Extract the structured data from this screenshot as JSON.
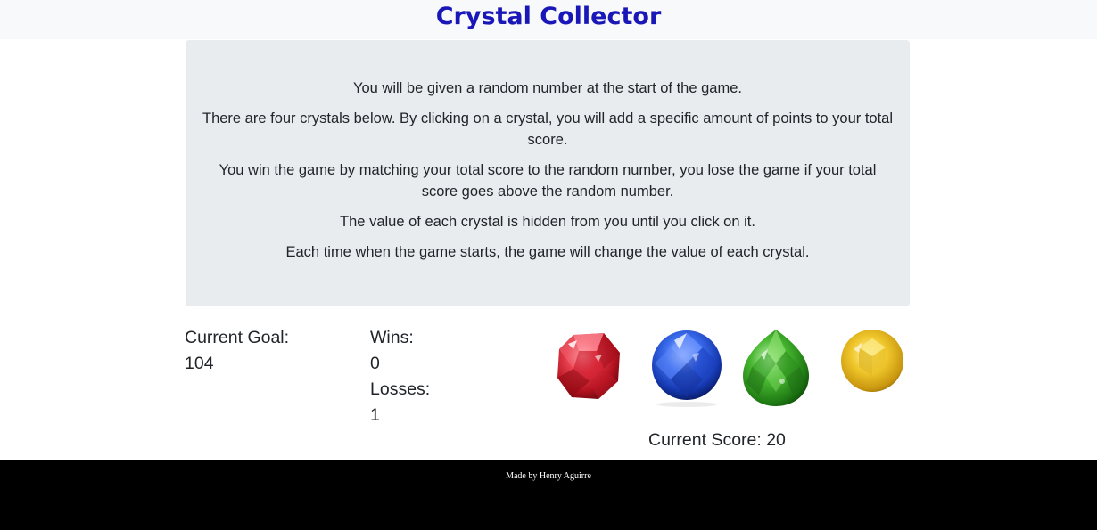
{
  "header": {
    "title": "Crystal Collector",
    "title_color": "#1a17b8"
  },
  "instructions": [
    "You will be given a random number at the start of the game.",
    "There are four crystals below. By clicking on a crystal, you will add a specific amount of points to your total score.",
    "You win the game by matching your total score to the random number, you lose the game if your total score goes above the random number.",
    "The value of each crystal is hidden from you until you click on it.",
    "Each time when the game starts, the game will change the value of each crystal."
  ],
  "stats": {
    "goal_label": "Current Goal:",
    "goal_value": "104",
    "wins_label": "Wins:",
    "wins_value": "0",
    "losses_label": "Losses:",
    "losses_value": "1"
  },
  "crystals": [
    {
      "icon": "red-crystal-icon",
      "color": "#e0303f"
    },
    {
      "icon": "blue-crystal-icon",
      "color": "#2a56d6"
    },
    {
      "icon": "green-crystal-icon",
      "color": "#3aa52a"
    },
    {
      "icon": "yellow-crystal-icon",
      "color": "#e8c021"
    }
  ],
  "score": {
    "text": "Current Score: 20"
  },
  "footer": {
    "text": "Made by Henry Aguirre"
  }
}
